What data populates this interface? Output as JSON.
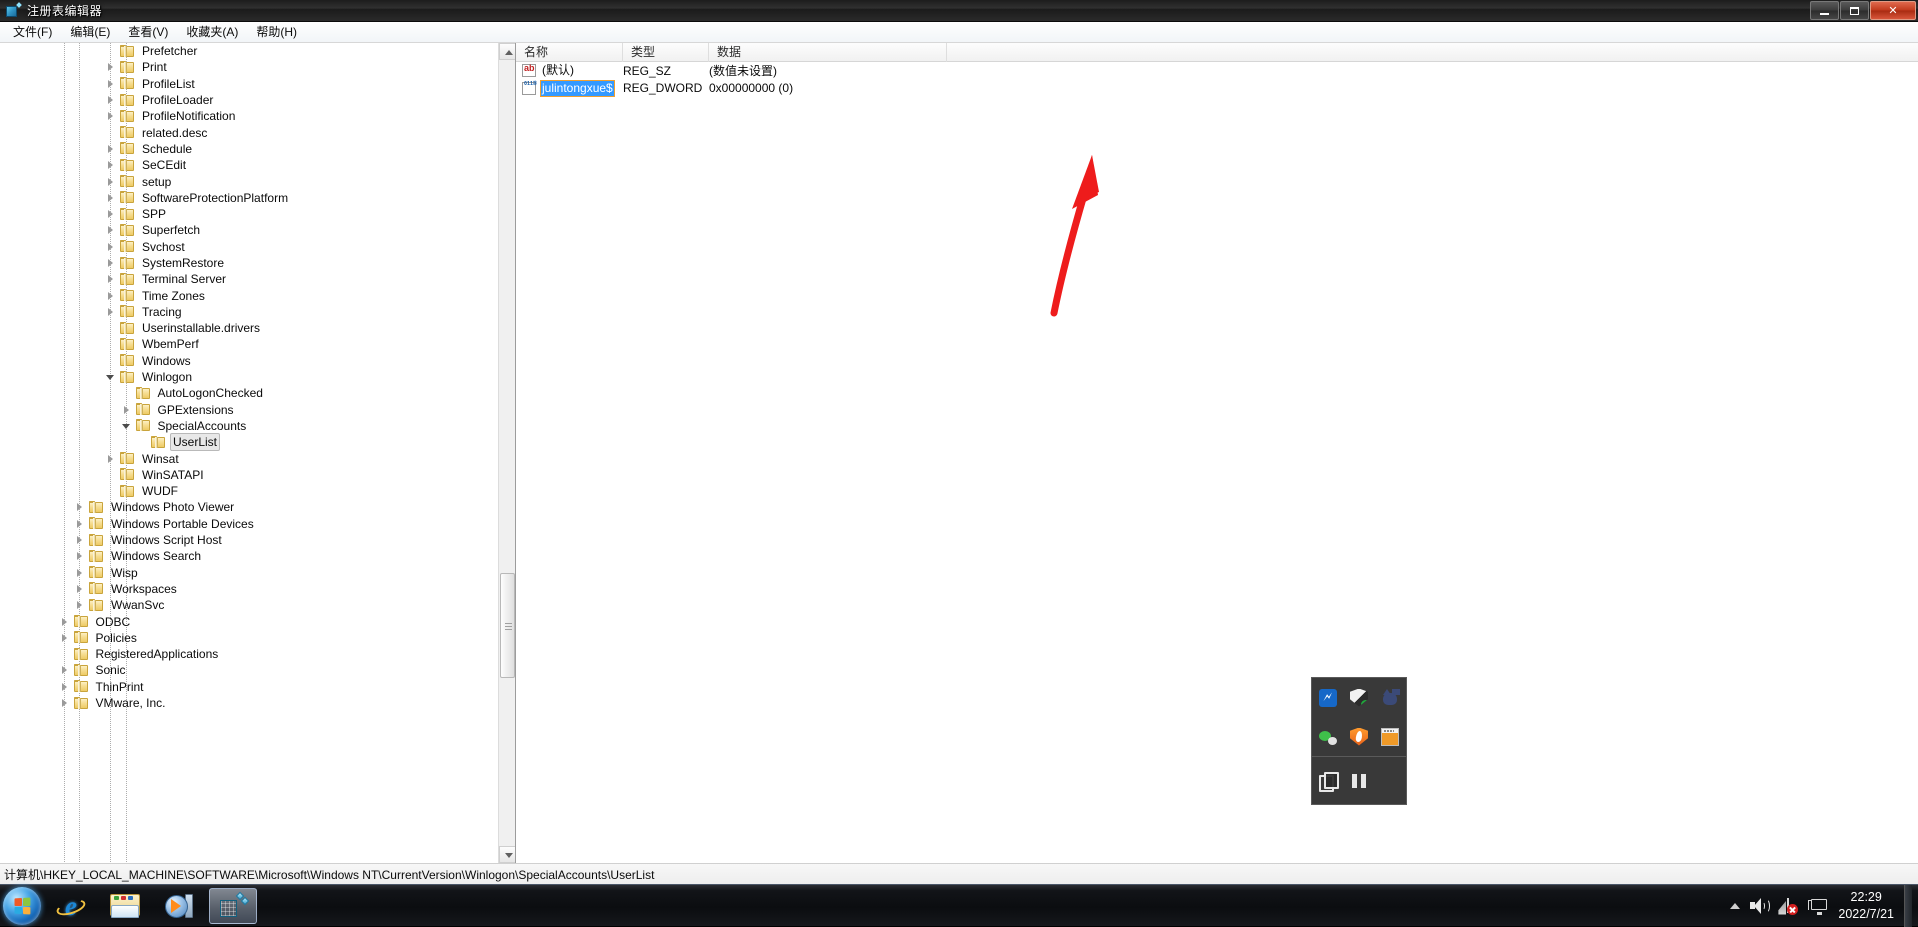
{
  "window": {
    "title": "注册表编辑器",
    "icon": "registry-icon",
    "controls": {
      "minimize": "最小化",
      "restore": "还原",
      "close": "关闭"
    }
  },
  "menubar": {
    "items": [
      {
        "label": "文件(F)",
        "name": "menu-file"
      },
      {
        "label": "编辑(E)",
        "name": "menu-edit"
      },
      {
        "label": "查看(V)",
        "name": "menu-view"
      },
      {
        "label": "收藏夹(A)",
        "name": "menu-favorites"
      },
      {
        "label": "帮助(H)",
        "name": "menu-help"
      }
    ]
  },
  "tree": {
    "rows": [
      {
        "label": "Prefetcher",
        "indent": 6,
        "state": "leaf"
      },
      {
        "label": "Print",
        "indent": 6,
        "state": "collapsed"
      },
      {
        "label": "ProfileList",
        "indent": 6,
        "state": "collapsed"
      },
      {
        "label": "ProfileLoader",
        "indent": 6,
        "state": "collapsed"
      },
      {
        "label": "ProfileNotification",
        "indent": 6,
        "state": "collapsed"
      },
      {
        "label": "related.desc",
        "indent": 6,
        "state": "leaf"
      },
      {
        "label": "Schedule",
        "indent": 6,
        "state": "collapsed"
      },
      {
        "label": "SeCEdit",
        "indent": 6,
        "state": "collapsed"
      },
      {
        "label": "setup",
        "indent": 6,
        "state": "collapsed"
      },
      {
        "label": "SoftwareProtectionPlatform",
        "indent": 6,
        "state": "collapsed"
      },
      {
        "label": "SPP",
        "indent": 6,
        "state": "collapsed"
      },
      {
        "label": "Superfetch",
        "indent": 6,
        "state": "collapsed"
      },
      {
        "label": "Svchost",
        "indent": 6,
        "state": "collapsed"
      },
      {
        "label": "SystemRestore",
        "indent": 6,
        "state": "collapsed"
      },
      {
        "label": "Terminal Server",
        "indent": 6,
        "state": "collapsed"
      },
      {
        "label": "Time Zones",
        "indent": 6,
        "state": "collapsed"
      },
      {
        "label": "Tracing",
        "indent": 6,
        "state": "collapsed"
      },
      {
        "label": "Userinstallable.drivers",
        "indent": 6,
        "state": "leaf"
      },
      {
        "label": "WbemPerf",
        "indent": 6,
        "state": "leaf"
      },
      {
        "label": "Windows",
        "indent": 6,
        "state": "leaf"
      },
      {
        "label": "Winlogon",
        "indent": 6,
        "state": "expanded"
      },
      {
        "label": "AutoLogonChecked",
        "indent": 7,
        "state": "leaf"
      },
      {
        "label": "GPExtensions",
        "indent": 7,
        "state": "collapsed"
      },
      {
        "label": "SpecialAccounts",
        "indent": 7,
        "state": "expanded"
      },
      {
        "label": "UserList",
        "indent": 8,
        "state": "leaf",
        "selected": true
      },
      {
        "label": "Winsat",
        "indent": 6,
        "state": "collapsed"
      },
      {
        "label": "WinSATAPI",
        "indent": 6,
        "state": "leaf"
      },
      {
        "label": "WUDF",
        "indent": 6,
        "state": "leaf"
      },
      {
        "label": "Windows Photo Viewer",
        "indent": 4,
        "state": "collapsed"
      },
      {
        "label": "Windows Portable Devices",
        "indent": 4,
        "state": "collapsed"
      },
      {
        "label": "Windows Script Host",
        "indent": 4,
        "state": "collapsed"
      },
      {
        "label": "Windows Search",
        "indent": 4,
        "state": "collapsed"
      },
      {
        "label": "Wisp",
        "indent": 4,
        "state": "collapsed"
      },
      {
        "label": "Workspaces",
        "indent": 4,
        "state": "collapsed"
      },
      {
        "label": "WwanSvc",
        "indent": 4,
        "state": "collapsed"
      },
      {
        "label": "ODBC",
        "indent": 3,
        "state": "collapsed"
      },
      {
        "label": "Policies",
        "indent": 3,
        "state": "collapsed"
      },
      {
        "label": "RegisteredApplications",
        "indent": 3,
        "state": "leaf"
      },
      {
        "label": "Sonic",
        "indent": 3,
        "state": "collapsed"
      },
      {
        "label": "ThinPrint",
        "indent": 3,
        "state": "collapsed"
      },
      {
        "label": "VMware, Inc.",
        "indent": 3,
        "state": "collapsed"
      }
    ]
  },
  "list": {
    "columns": [
      "名称",
      "类型",
      "数据"
    ],
    "rows": [
      {
        "name": "(默认)",
        "type": "REG_SZ",
        "data": "(数值未设置)",
        "icon": "string-value-icon",
        "selected": false
      },
      {
        "name": "julintongxue$",
        "type": "REG_DWORD",
        "data": "0x00000000 (0)",
        "icon": "dword-value-icon",
        "selected": true
      }
    ]
  },
  "annotation": {
    "type": "red-arrow",
    "color": "#ee1c1c",
    "points_to": "julintongxue$"
  },
  "statusbar": {
    "path": "计算机\\HKEY_LOCAL_MACHINE\\SOFTWARE\\Microsoft\\Windows NT\\CurrentVersion\\Winlogon\\SpecialAccounts\\UserList"
  },
  "taskbar": {
    "start": "start-orb",
    "items": [
      {
        "name": "taskbar-internet-explorer",
        "icon": "internet-explorer-icon",
        "active": false
      },
      {
        "name": "taskbar-file-explorer",
        "icon": "folder-explorer-icon",
        "active": false
      },
      {
        "name": "taskbar-media-player",
        "icon": "media-player-icon",
        "active": false
      },
      {
        "name": "taskbar-registry-editor",
        "icon": "registry-editor-icon",
        "active": true
      }
    ],
    "tray_popup": [
      {
        "name": "tray-bluetooth",
        "icon": "bluetooth-icon"
      },
      {
        "name": "tray-defender",
        "icon": "shield-check-icon"
      },
      {
        "name": "tray-cat-app",
        "icon": "cat-icon"
      },
      {
        "name": "tray-wechat",
        "icon": "wechat-icon"
      },
      {
        "name": "tray-firewall",
        "icon": "flame-shield-icon"
      },
      {
        "name": "tray-window-app",
        "icon": "window-icon"
      },
      {
        "name": "tray-clipboard",
        "icon": "copy-icon"
      },
      {
        "name": "tray-pause",
        "icon": "pause-icon"
      }
    ],
    "tray": {
      "overflow": "show-hidden-icons-arrow",
      "volume": "speaker-icon",
      "network": "network-error-icon",
      "display": "display-icon"
    },
    "clock": {
      "time": "22:29",
      "date": "2022/7/21"
    }
  }
}
